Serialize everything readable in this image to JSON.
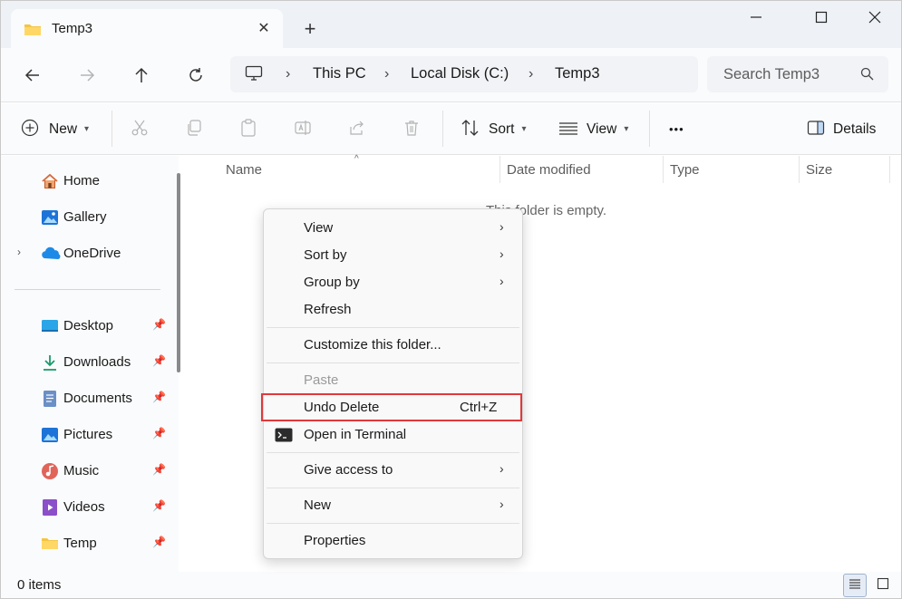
{
  "tab": {
    "title": "Temp3",
    "close_glyph": "✕",
    "new_tab_glyph": "+"
  },
  "address": {
    "crumbs": [
      "This PC",
      "Local Disk (C:)",
      "Temp3"
    ],
    "separator": "›"
  },
  "search": {
    "placeholder": "Search Temp3"
  },
  "toolbar": {
    "new_label": "New",
    "sort_label": "Sort",
    "view_label": "View",
    "more_label": "•••",
    "details_label": "Details"
  },
  "sidebar": {
    "top_items": [
      {
        "label": "Home",
        "icon": "home-icon"
      },
      {
        "label": "Gallery",
        "icon": "gallery-icon"
      },
      {
        "label": "OneDrive",
        "icon": "onedrive-icon"
      }
    ],
    "quick_access": [
      {
        "label": "Desktop",
        "icon": "desktop-icon"
      },
      {
        "label": "Downloads",
        "icon": "downloads-icon"
      },
      {
        "label": "Documents",
        "icon": "documents-icon"
      },
      {
        "label": "Pictures",
        "icon": "pictures-icon"
      },
      {
        "label": "Music",
        "icon": "music-icon"
      },
      {
        "label": "Videos",
        "icon": "videos-icon"
      },
      {
        "label": "Temp",
        "icon": "folder-icon"
      }
    ]
  },
  "columns": {
    "name": "Name",
    "date_modified": "Date modified",
    "type": "Type",
    "size": "Size"
  },
  "empty_message": "This folder is empty.",
  "status": {
    "item_count": "0 items"
  },
  "context_menu": {
    "view": "View",
    "sort_by": "Sort by",
    "group_by": "Group by",
    "refresh": "Refresh",
    "customize": "Customize this folder...",
    "paste": "Paste",
    "undo_delete": "Undo Delete",
    "undo_shortcut": "Ctrl+Z",
    "open_terminal": "Open in Terminal",
    "give_access": "Give access to",
    "new": "New",
    "properties": "Properties",
    "submenu_arrow": "›"
  },
  "colors": {
    "highlight_border": "#e0393b",
    "folder_yellow": "#f4c542",
    "accent_blue": "#1e73d8"
  }
}
